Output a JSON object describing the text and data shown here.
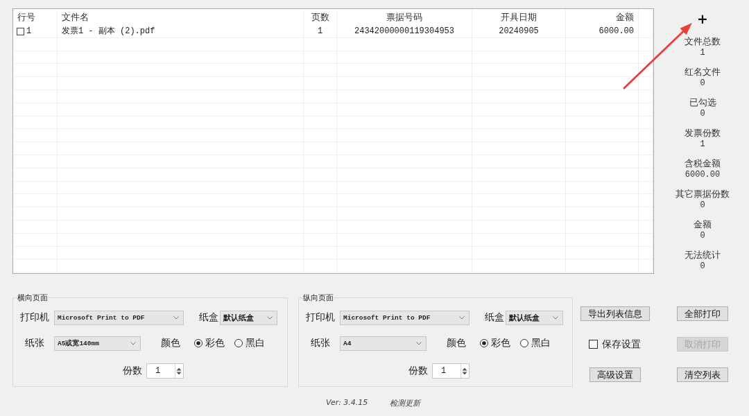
{
  "table": {
    "columns": [
      "行号",
      "文件名",
      "页数",
      "票据号码",
      "开具日期",
      "金额"
    ],
    "rows": [
      {
        "checked": false,
        "cells": [
          "1",
          "发票1 - 副本 (2).pdf",
          "1",
          "24342000000119304953",
          "20240905",
          "6000.00"
        ]
      }
    ]
  },
  "add_button": "+",
  "stats": [
    {
      "label": "文件总数",
      "value": "1"
    },
    {
      "label": "红名文件",
      "value": "0"
    },
    {
      "label": "已勾选",
      "value": "0"
    },
    {
      "label": "发票份数",
      "value": "1"
    },
    {
      "label": "含税金额",
      "value": "6000.00"
    },
    {
      "label": "其它票据份数",
      "value": "0"
    },
    {
      "label": "金额",
      "value": "0"
    },
    {
      "label": "无法统计",
      "value": "0"
    }
  ],
  "groups": [
    {
      "title": "横向页面",
      "printer_label": "打印机",
      "printer": "Microsoft Print to PDF",
      "tray_label": "纸盒",
      "tray": "默认纸盒",
      "paper_label": "纸张",
      "paper": "A5或宽140mm",
      "color_label": "颜色",
      "color_options": [
        {
          "label": "彩色",
          "selected": true
        },
        {
          "label": "黑白",
          "selected": false
        }
      ],
      "copies_label": "份数",
      "copies": "1"
    },
    {
      "title": "纵向页面",
      "printer_label": "打印机",
      "printer": "Microsoft Print to PDF",
      "tray_label": "纸盒",
      "tray": "默认纸盒",
      "paper_label": "纸张",
      "paper": "A4",
      "color_label": "颜色",
      "color_options": [
        {
          "label": "彩色",
          "selected": true
        },
        {
          "label": "黑白",
          "selected": false
        }
      ],
      "copies_label": "份数",
      "copies": "1"
    }
  ],
  "actions": [
    {
      "kind": "button",
      "label": "导出列表信息",
      "disabled": false
    },
    {
      "kind": "button",
      "label": "全部打印",
      "disabled": false
    },
    {
      "kind": "checkbox",
      "label": "保存设置",
      "checked": false
    },
    {
      "kind": "button",
      "label": "取消打印",
      "disabled": true
    },
    {
      "kind": "button",
      "label": "高级设置",
      "disabled": false
    },
    {
      "kind": "button",
      "label": "清空列表",
      "disabled": false
    }
  ],
  "footer": {
    "version": "Ver: 3.4.15",
    "update_link": "检测更新"
  }
}
